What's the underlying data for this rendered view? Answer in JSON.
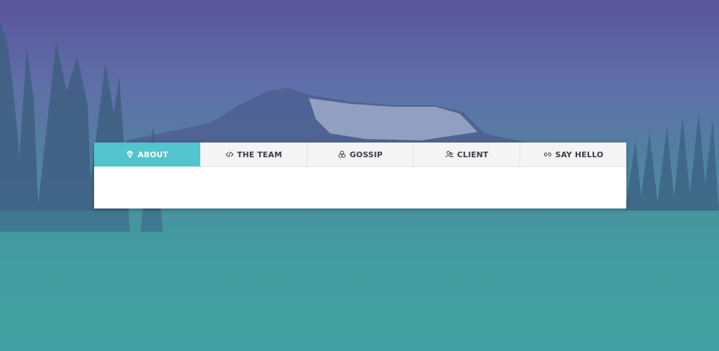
{
  "tabs": [
    {
      "label": "ABOUT",
      "icon": "diamond-icon",
      "active": true
    },
    {
      "label": "THE TEAM",
      "icon": "code-icon",
      "active": false
    },
    {
      "label": "GOSSIP",
      "icon": "triangle-knot-icon",
      "active": false
    },
    {
      "label": "CLIENT",
      "icon": "users-icon",
      "active": false
    },
    {
      "label": "SAY HELLO",
      "icon": "link-icon",
      "active": false
    }
  ],
  "colors": {
    "active_tab": "#52c4cb",
    "tab_bar": "#f4f4f4",
    "tab_text": "#3b3b4f",
    "bg_top": "#5b549c",
    "bg_bottom": "#43a5a2"
  }
}
